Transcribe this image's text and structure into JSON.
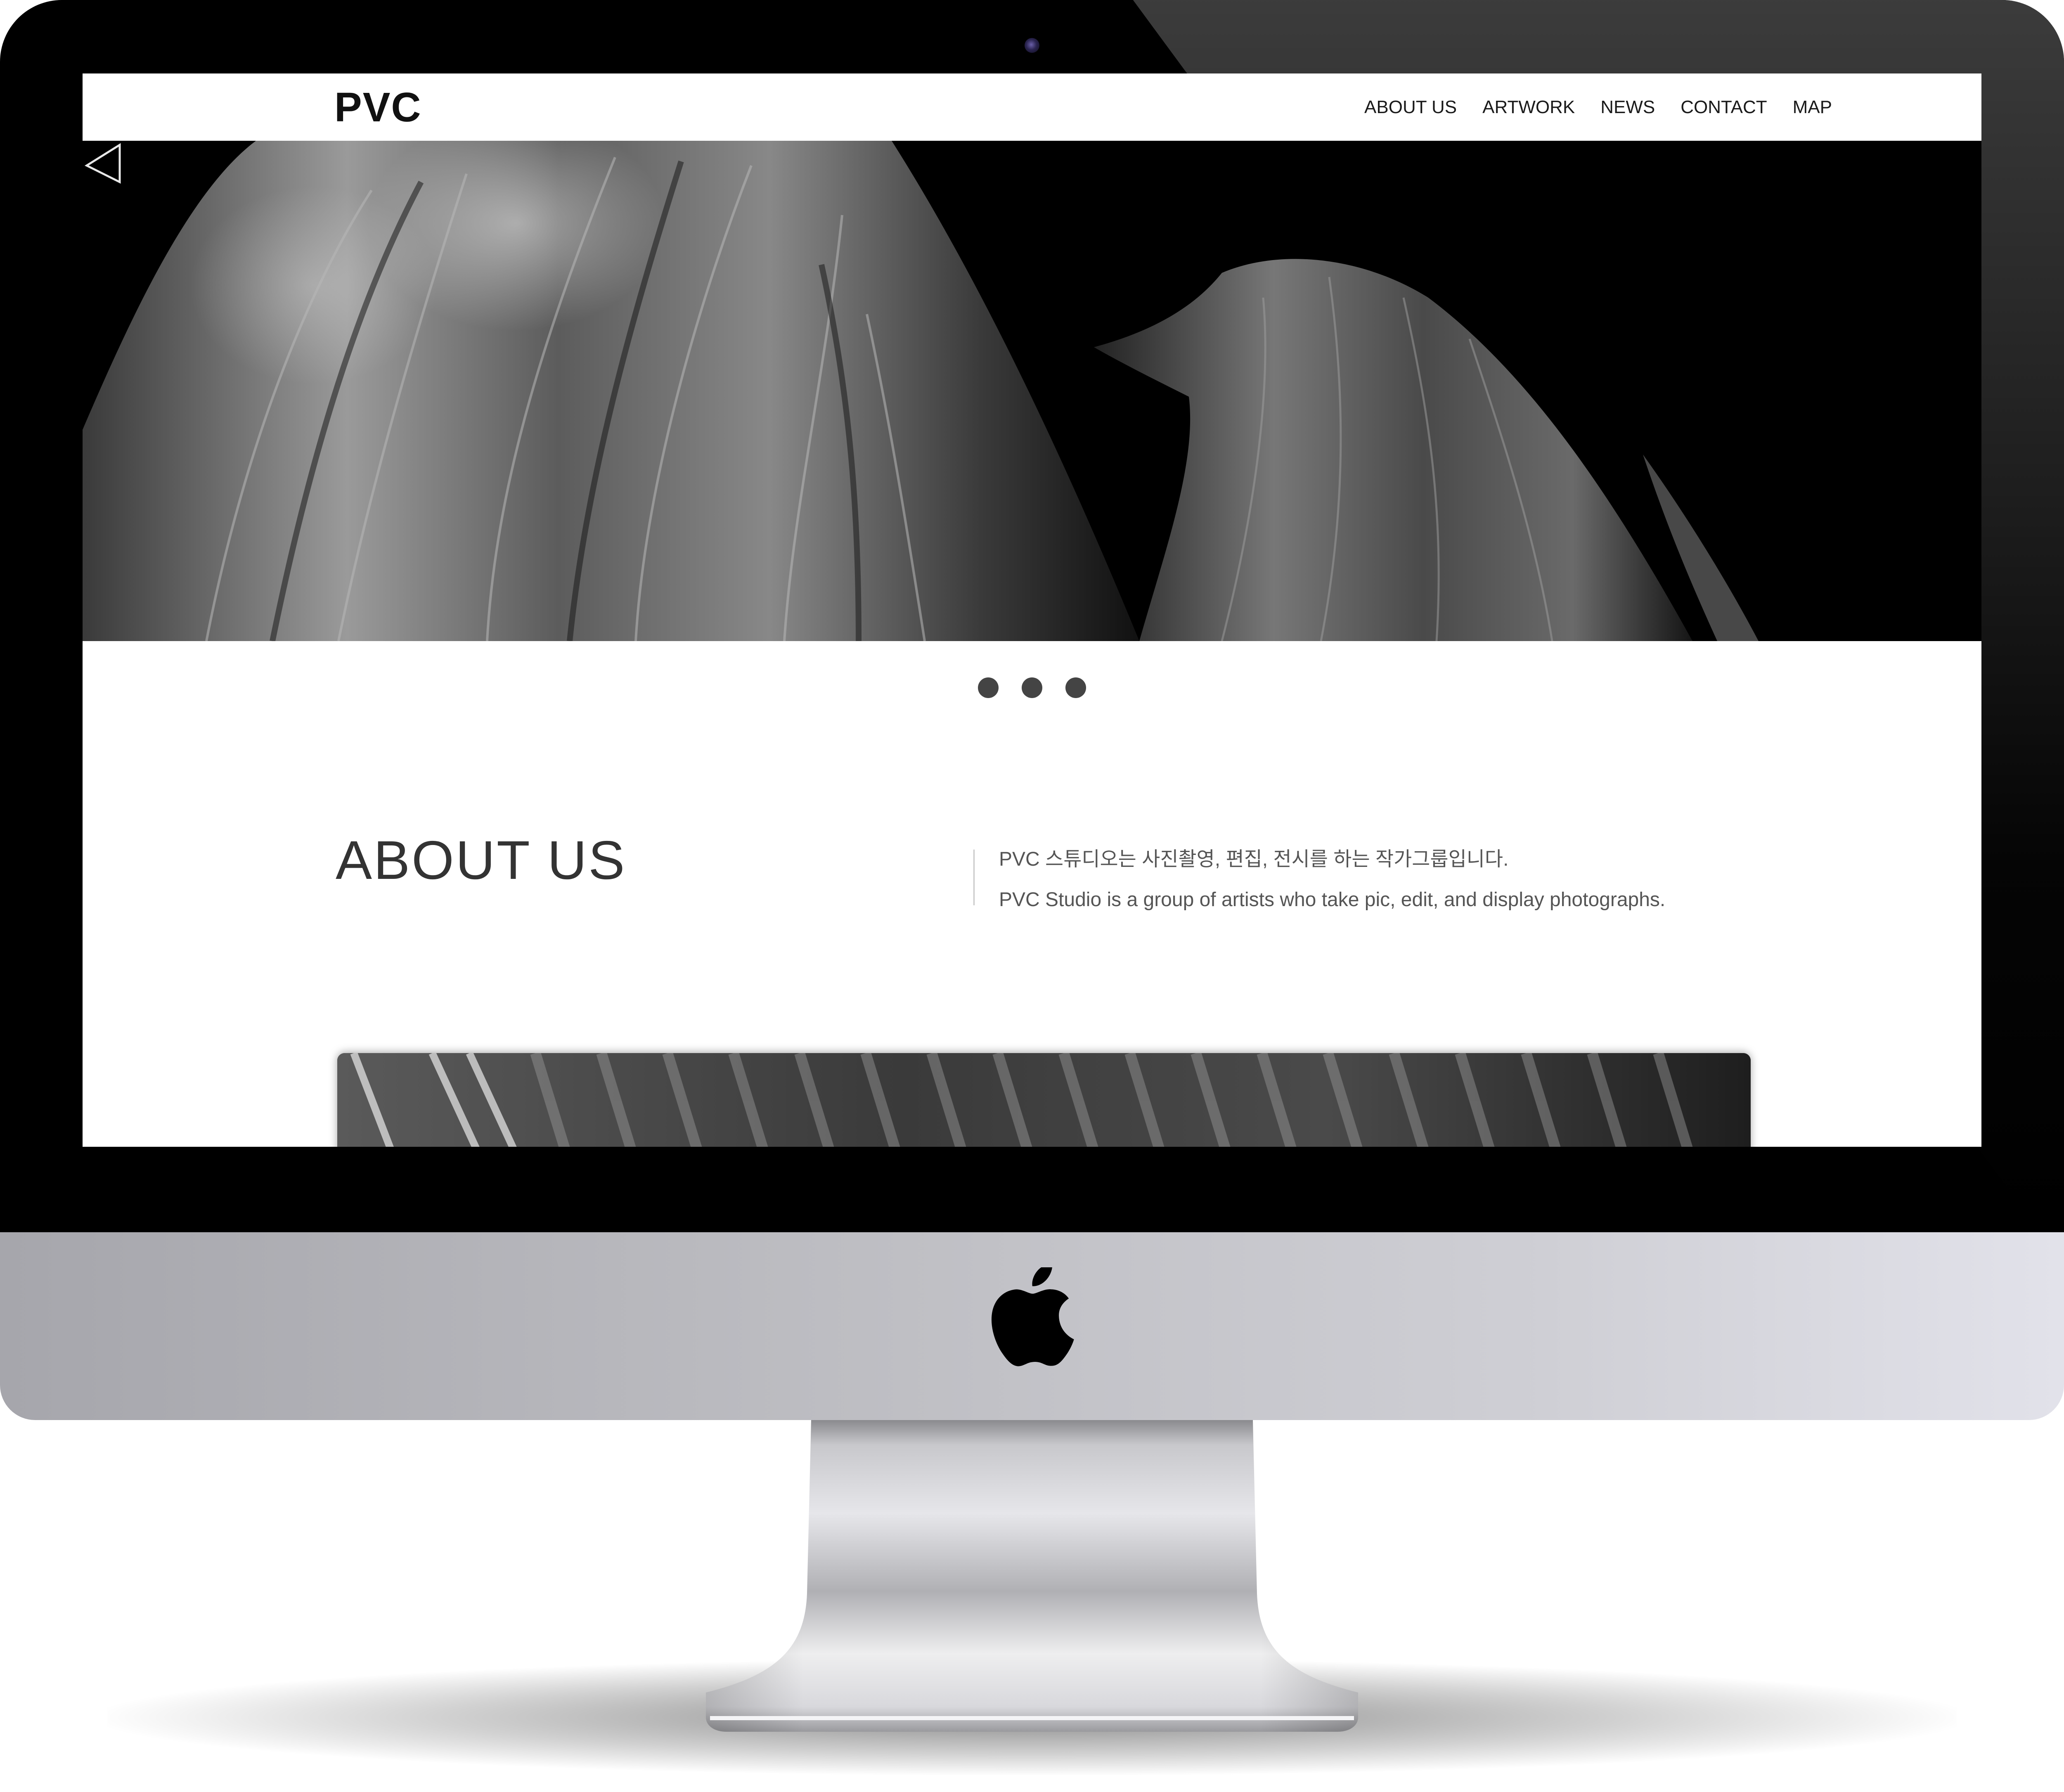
{
  "site": {
    "logo": "PVC"
  },
  "nav": {
    "items": [
      {
        "label": "ABOUT US"
      },
      {
        "label": "ARTWORK"
      },
      {
        "label": "NEWS"
      },
      {
        "label": "CONTACT"
      },
      {
        "label": "MAP"
      }
    ]
  },
  "hero": {
    "prev_icon": "triangle-left-outline-icon",
    "slides": 3,
    "active_slide": 1
  },
  "about": {
    "title": "ABOUT US",
    "line_ko": "PVC 스튜디오는 사진촬영, 편집, 전시를 하는 작가그룹입니다.",
    "line_en": "PVC Studio is a group of artists who take pic, edit, and display photographs."
  },
  "device": {
    "logo_icon": "apple-logo-icon"
  },
  "colors": {
    "bezel": "#000000",
    "chin": "#c4c4ca",
    "text_dark": "#1a1a1a",
    "text_muted": "#555555",
    "dot": "#444444"
  }
}
